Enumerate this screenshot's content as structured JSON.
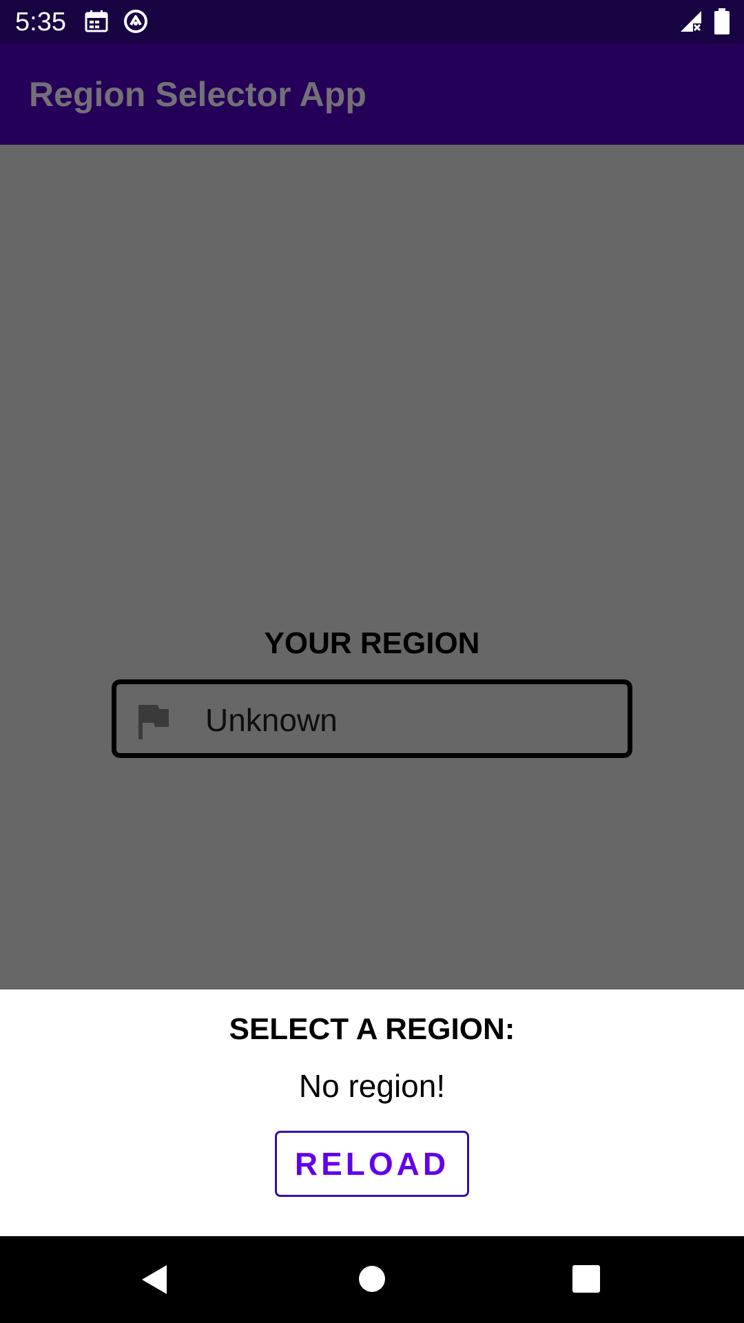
{
  "status_bar": {
    "time": "5:35",
    "icons": [
      "calendar-icon",
      "sync-circle-icon",
      "signal-icon",
      "battery-icon"
    ]
  },
  "app_bar": {
    "title": "Region Selector App"
  },
  "main": {
    "heading": "YOUR REGION",
    "region_icon": "flag-icon",
    "region_value": "Unknown"
  },
  "bottom_sheet": {
    "heading": "SELECT A REGION:",
    "message": "No region!",
    "reload_label": "RELOAD"
  },
  "nav_bar": {
    "buttons": [
      "back-icon",
      "home-icon",
      "recents-icon"
    ]
  },
  "colors": {
    "status_bar": "#180443",
    "app_bar": "#250059",
    "scrim": "#676767",
    "accent": "#6200ee",
    "sheet": "#ffffff"
  }
}
